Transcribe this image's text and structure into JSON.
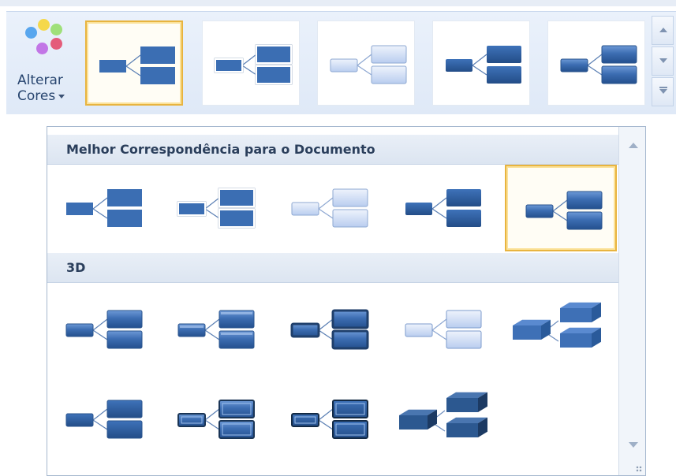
{
  "ribbon": {
    "change_colors": {
      "line1": "Alterar",
      "line2": "Cores",
      "icon": "color-palette-icon",
      "dot_colors": [
        "#f5d84a",
        "#9fe07a",
        "#58a6ee",
        "#e45c7a",
        "#c276e6"
      ]
    },
    "styles": [
      {
        "style": "flat",
        "selected": true
      },
      {
        "style": "outline",
        "selected": false
      },
      {
        "style": "light",
        "selected": false
      },
      {
        "style": "dark",
        "selected": false
      },
      {
        "style": "gloss",
        "selected": false
      }
    ],
    "scroll": {
      "up_icon": "scroll-up-icon",
      "down_icon": "scroll-down-icon",
      "more_icon": "more-styles-icon"
    }
  },
  "gallery": {
    "sections": [
      {
        "title": "Melhor Correspondência para o Documento",
        "items": [
          {
            "style": "flat",
            "selected": false
          },
          {
            "style": "outline",
            "selected": false
          },
          {
            "style": "light",
            "selected": false
          },
          {
            "style": "dark",
            "selected": false
          },
          {
            "style": "gloss",
            "selected": true
          }
        ]
      },
      {
        "title": "3D",
        "items": [
          {
            "style": "gloss",
            "selected": false
          },
          {
            "style": "bevel",
            "selected": false
          },
          {
            "style": "framed",
            "selected": false
          },
          {
            "style": "faded",
            "selected": false
          },
          {
            "style": "cube",
            "selected": false
          },
          {
            "style": "flat-shadow",
            "selected": false
          },
          {
            "style": "inset",
            "selected": false
          },
          {
            "style": "inset-dark",
            "selected": false
          },
          {
            "style": "blocks",
            "selected": false
          }
        ]
      }
    ]
  },
  "colors": {
    "accent": "#e8b43f",
    "shape_fill": "#3b6eb3",
    "shape_light": "#c9d9f4",
    "header_text": "#2b3f5c"
  }
}
